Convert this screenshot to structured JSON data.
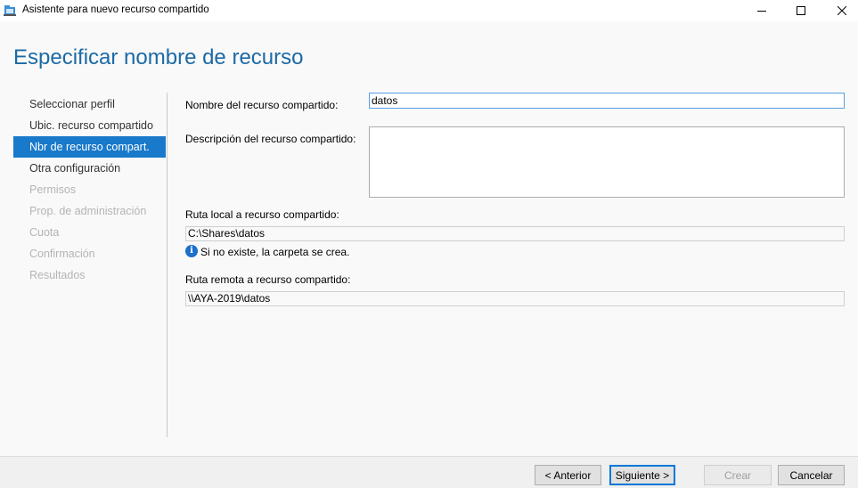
{
  "window": {
    "title": "Asistente para nuevo recurso compartido",
    "icon": "share-folder-icon",
    "controls": {
      "minimize": "minimize-icon",
      "maximize": "maximize-icon",
      "close": "close-icon"
    }
  },
  "page": {
    "heading": "Especificar nombre de recurso"
  },
  "nav": {
    "items": [
      {
        "label": "Seleccionar perfil",
        "state": "done"
      },
      {
        "label": "Ubic. recurso compartido",
        "state": "done"
      },
      {
        "label": "Nbr de recurso compart.",
        "state": "active"
      },
      {
        "label": "Otra configuración",
        "state": "done"
      },
      {
        "label": "Permisos",
        "state": "disabled"
      },
      {
        "label": "Prop. de administración",
        "state": "disabled"
      },
      {
        "label": "Cuota",
        "state": "disabled"
      },
      {
        "label": "Confirmación",
        "state": "disabled"
      },
      {
        "label": "Resultados",
        "state": "disabled"
      }
    ]
  },
  "form": {
    "share_name_label": "Nombre del recurso compartido:",
    "share_name_value": "datos",
    "description_label": "Descripción del recurso compartido:",
    "description_value": "",
    "local_path_label": "Ruta local a recurso compartido:",
    "local_path_value": "C:\\Shares\\datos",
    "info_text": "Si no existe, la carpeta se crea.",
    "remote_path_label": "Ruta remota a recurso compartido:",
    "remote_path_value": "\\\\AYA-2019\\datos"
  },
  "buttons": {
    "previous": "< Anterior",
    "next": "Siguiente >",
    "create": "Crear",
    "cancel": "Cancelar"
  },
  "colors": {
    "heading": "#1c6aa5",
    "nav_active_bg": "#1979ca",
    "focus_border": "#569de5"
  }
}
